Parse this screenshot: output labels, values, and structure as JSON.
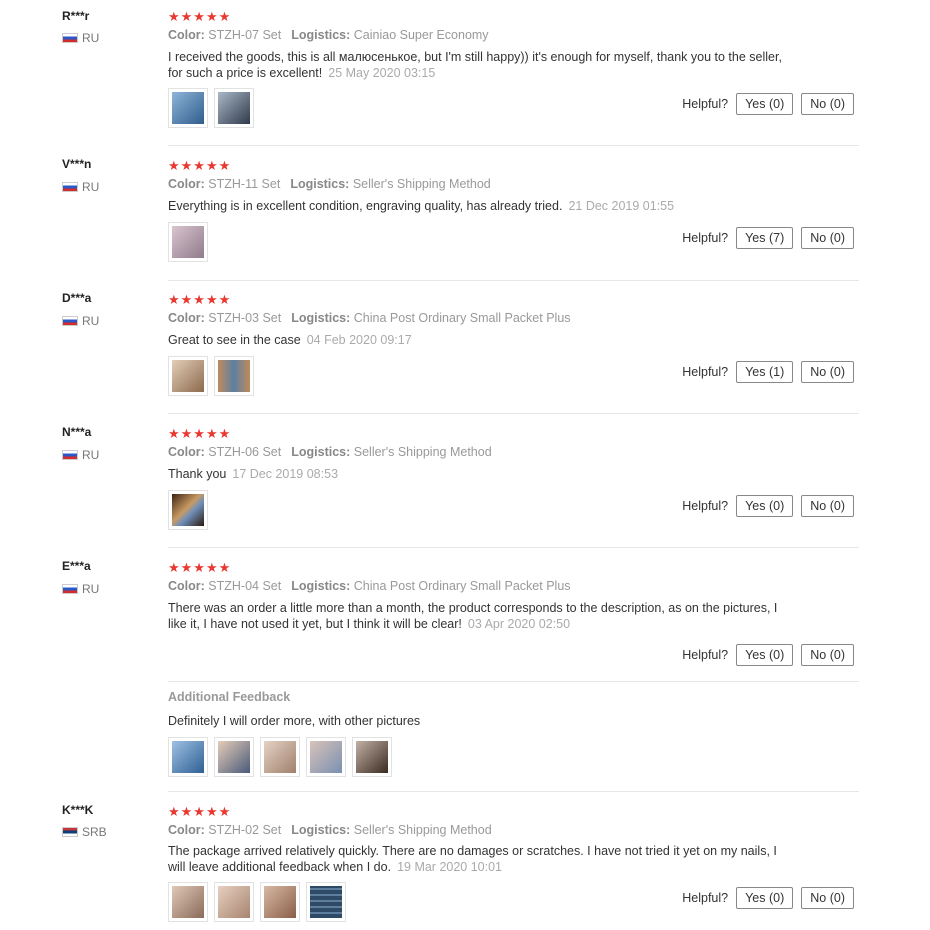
{
  "labels": {
    "color": "Color:",
    "logistics": "Logistics:",
    "helpful": "Helpful?",
    "additional_feedback": "Additional Feedback"
  },
  "stars": "★★★★★",
  "reviews": [
    {
      "user": "R***r",
      "country": "RU",
      "color": "STZH-07 Set",
      "logistics": "Cainiao Super Economy",
      "text": "I received the goods, this is all малюсенькое, but I'm still happy)) it's enough for myself, thank you to the seller, for such a price is excellent!",
      "date": "25 May 2020 03:15",
      "yes": "Yes (0)",
      "no": "No (0)",
      "photos": [
        "#5d88b5",
        "#3f4f66"
      ]
    },
    {
      "user": "V***n",
      "country": "RU",
      "color": "STZH-11 Set",
      "logistics": "Seller's Shipping Method",
      "text": "Everything is in excellent condition, engraving quality, has already tried.",
      "date": "21 Dec 2019 01:55",
      "yes": "Yes (7)",
      "no": "No (0)",
      "photos": [
        "#b79aa8"
      ]
    },
    {
      "user": "D***a",
      "country": "RU",
      "color": "STZH-03 Set",
      "logistics": "China Post Ordinary Small Packet Plus",
      "text": "Great to see in the case",
      "date": "04 Feb 2020 09:17",
      "yes": "Yes (1)",
      "no": "No (0)",
      "photos": [
        "#b89678",
        "#9c6f4a"
      ]
    },
    {
      "user": "N***a",
      "country": "RU",
      "color": "STZH-06 Set",
      "logistics": "Seller's Shipping Method",
      "text": "Thank you",
      "date": "17 Dec 2019 08:53",
      "yes": "Yes (0)",
      "no": "No (0)",
      "photos": [
        "#6c4a2c"
      ]
    },
    {
      "user": "E***a",
      "country": "RU",
      "color": "STZH-04 Set",
      "logistics": "China Post Ordinary Small Packet Plus",
      "text": "There was an order a little more than a month, the product corresponds to the description, as on the pictures, I like it, I have not used it yet, but I think it will be clear!",
      "date": "03 Apr 2020 02:50",
      "yes": "Yes (0)",
      "no": "No (0)",
      "additional_text": "Definitely I will order more, with other pictures",
      "photos": [
        "#4f7fb0",
        "#c9a68a",
        "#c7b2a0",
        "#b49a91",
        "#6a5446"
      ]
    },
    {
      "user": "K***K",
      "country": "SRB",
      "color": "STZH-02 Set",
      "logistics": "Seller's Shipping Method",
      "text": "The package arrived relatively quickly. There are no damages or scratches. I have not tried it yet on my nails, I will leave additional feedback when I do.",
      "date": "19 Mar 2020 10:01",
      "yes": "Yes (0)",
      "no": "No (0)",
      "photos": [
        "#c5a48f",
        "#c9a896",
        "#b98f7a",
        "#3e5670"
      ]
    }
  ]
}
